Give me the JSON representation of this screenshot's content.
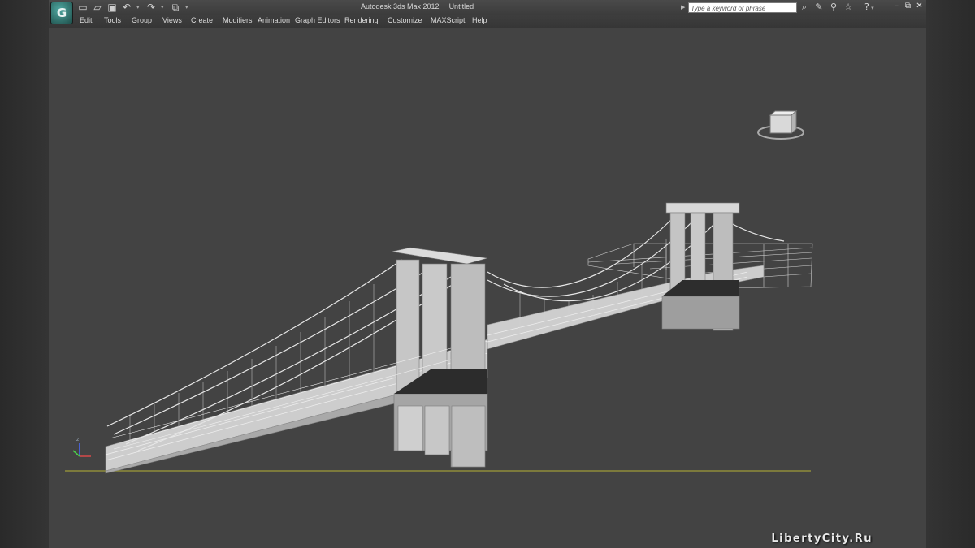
{
  "app": {
    "title": "Autodesk 3ds Max  2012",
    "document": "Untitled",
    "logo_glyph": "G"
  },
  "quick_access": [
    {
      "icon": "new-file-icon",
      "glyph": "▭"
    },
    {
      "icon": "open-folder-icon",
      "glyph": "▱"
    },
    {
      "icon": "save-icon",
      "glyph": "▣"
    },
    {
      "icon": "undo-icon",
      "glyph": "↶"
    },
    {
      "icon": "redo-icon",
      "glyph": "↷"
    },
    {
      "icon": "project-folder-icon",
      "glyph": "⧉"
    }
  ],
  "search": {
    "placeholder": "Type a keyword or phrase"
  },
  "toolbar_icons": [
    {
      "icon": "binoculars-icon",
      "glyph": "⌕"
    },
    {
      "icon": "communication-center-icon",
      "glyph": "✎"
    },
    {
      "icon": "subscription-center-icon",
      "glyph": "⚲"
    },
    {
      "icon": "favorites-star-icon",
      "glyph": "☆"
    }
  ],
  "help_glyph": "?",
  "window_controls": {
    "minimize": "–",
    "restore": "⧉",
    "close": "✕"
  },
  "menu": [
    "Edit",
    "Tools",
    "Group",
    "Views",
    "Create",
    "Modifiers",
    "Animation",
    "Graph Editors",
    "Rendering",
    "Customize",
    "MAXScript",
    "Help"
  ],
  "viewport": {
    "background": "#434343",
    "grid_color": "#9a9a3a",
    "model_color": "#cfcfcf"
  },
  "watermark": "LibertyCity.Ru"
}
